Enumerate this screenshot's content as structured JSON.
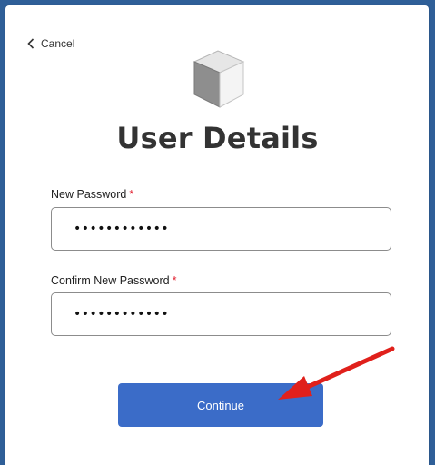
{
  "header": {
    "cancel_label": "Cancel",
    "logo_icon": "cube-icon"
  },
  "main": {
    "title": "User Details",
    "new_password": {
      "label": "New Password",
      "required_mark": "*",
      "value": "••••••••••••"
    },
    "confirm_password": {
      "label": "Confirm New Password",
      "required_mark": "*",
      "value": "••••••••••••"
    },
    "continue_label": "Continue"
  },
  "colors": {
    "frame_border": "#2f5f98",
    "button": "#3b6cc8",
    "required": "#e11b2b",
    "annotation_arrow": "#e0201b"
  }
}
